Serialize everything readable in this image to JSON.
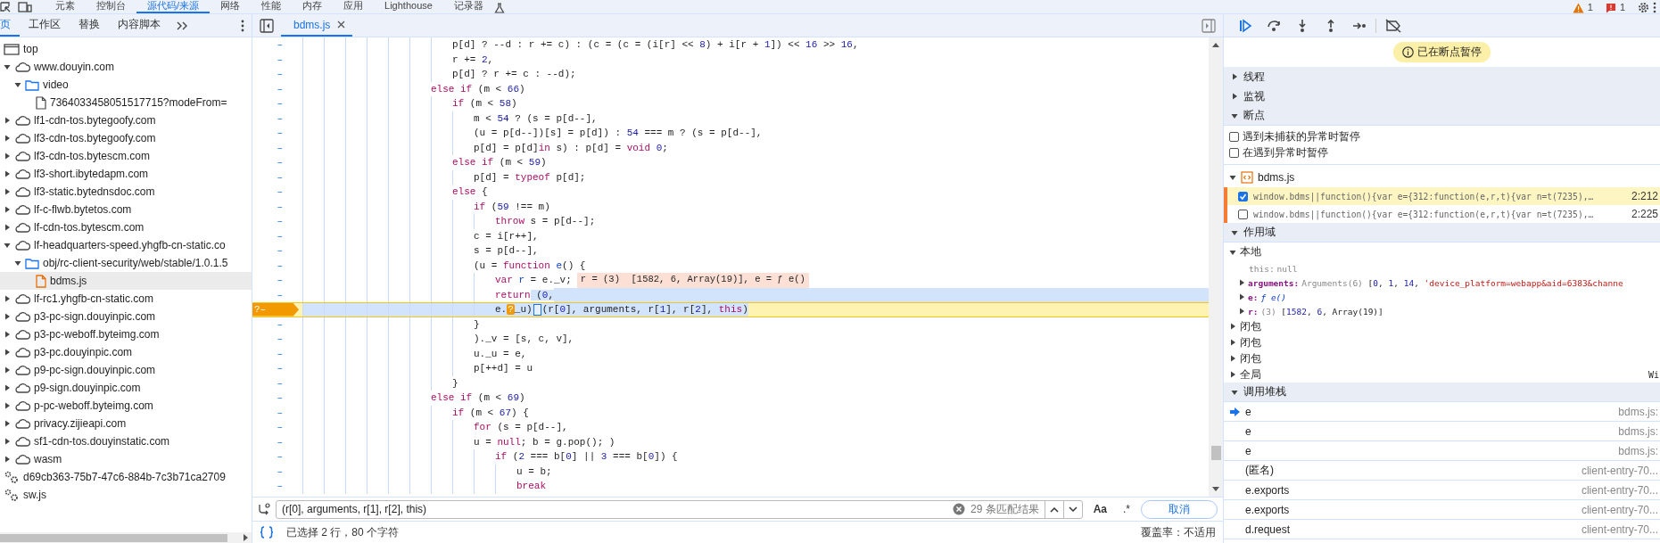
{
  "top_tabs": [
    {
      "label": "元素",
      "selected": false
    },
    {
      "label": "控制台",
      "selected": false
    },
    {
      "label": "源代码/来源",
      "selected": true
    },
    {
      "label": "网络",
      "selected": false
    },
    {
      "label": "性能",
      "selected": false
    },
    {
      "label": "内存",
      "selected": false
    },
    {
      "label": "应用",
      "selected": false
    },
    {
      "label": "Lighthouse",
      "selected": false
    },
    {
      "label": "记录器",
      "selected": false
    }
  ],
  "top_status": {
    "warnings": "1",
    "errors": "1"
  },
  "navigator": {
    "tabs": [
      {
        "label": "页",
        "selected": true
      },
      {
        "label": "工作区",
        "selected": false
      },
      {
        "label": "替换",
        "selected": false
      },
      {
        "label": "内容脚本",
        "selected": false
      }
    ],
    "tree": [
      {
        "kind": "frame",
        "label": "top",
        "selected": false
      },
      {
        "kind": "domain",
        "label": "www.douyin.com",
        "expanded": true,
        "selected": false,
        "children": [
          {
            "kind": "folder",
            "label": "video",
            "expanded": true,
            "selected": false,
            "children": [
              {
                "kind": "file",
                "label": "7364033458051517715?modeFrom=",
                "selected": false
              }
            ]
          }
        ]
      },
      {
        "kind": "domain",
        "label": "lf1-cdn-tos.bytegoofy.com",
        "expanded": false,
        "selected": false
      },
      {
        "kind": "domain",
        "label": "lf3-cdn-tos.bytegoofy.com",
        "expanded": false,
        "selected": false
      },
      {
        "kind": "domain",
        "label": "lf3-cdn-tos.bytescm.com",
        "expanded": false,
        "selected": false
      },
      {
        "kind": "domain",
        "label": "lf3-short.ibytedapm.com",
        "expanded": false,
        "selected": false
      },
      {
        "kind": "domain",
        "label": "lf3-static.bytednsdoc.com",
        "expanded": false,
        "selected": false
      },
      {
        "kind": "domain",
        "label": "lf-c-flwb.bytetos.com",
        "expanded": false,
        "selected": false
      },
      {
        "kind": "domain",
        "label": "lf-cdn-tos.bytescm.com",
        "expanded": false,
        "selected": false
      },
      {
        "kind": "domain",
        "label": "lf-headquarters-speed.yhgfb-cn-static.co",
        "expanded": true,
        "selected": false,
        "children": [
          {
            "kind": "folder",
            "label": "obj/rc-client-security/web/stable/1.0.1.5",
            "expanded": true,
            "selected": false,
            "children": [
              {
                "kind": "script",
                "label": "bdms.js",
                "selected": true
              }
            ]
          }
        ]
      },
      {
        "kind": "domain",
        "label": "lf-rc1.yhgfb-cn-static.com",
        "expanded": false,
        "selected": false
      },
      {
        "kind": "domain",
        "label": "p3-pc-sign.douyinpic.com",
        "expanded": false,
        "selected": false
      },
      {
        "kind": "domain",
        "label": "p3-pc-weboff.byteimg.com",
        "expanded": false,
        "selected": false
      },
      {
        "kind": "domain",
        "label": "p3-pc.douyinpic.com",
        "expanded": false,
        "selected": false
      },
      {
        "kind": "domain",
        "label": "p9-pc-sign.douyinpic.com",
        "expanded": false,
        "selected": false
      },
      {
        "kind": "domain",
        "label": "p9-sign.douyinpic.com",
        "expanded": false,
        "selected": false
      },
      {
        "kind": "domain",
        "label": "p-pc-weboff.byteimg.com",
        "expanded": false,
        "selected": false
      },
      {
        "kind": "domain",
        "label": "privacy.zijieapi.com",
        "expanded": false,
        "selected": false
      },
      {
        "kind": "domain",
        "label": "sf1-cdn-tos.douyinstatic.com",
        "expanded": false,
        "selected": false
      },
      {
        "kind": "domain",
        "label": "wasm",
        "expanded": false,
        "selected": false
      },
      {
        "kind": "worker",
        "label": "d69cb363-75b7-47c6-884b-7c3b71ca2709",
        "selected": false
      },
      {
        "kind": "worker",
        "label": "sw.js",
        "selected": false
      }
    ]
  },
  "editor": {
    "tabs": [
      {
        "label": "bdms.js",
        "selected": true
      }
    ],
    "lines": [
      {
        "marker": "–",
        "paused": false,
        "selected": false,
        "code": [
          {
            "kind": "plain",
            "text": "\t\t\t\t\t\t\tp[d] ? --d : r += c) : (c = (c = (i[r] <<"
          },
          {
            "kind": "number",
            "text": " 8"
          },
          {
            "kind": "plain",
            "text": ") + i[r +"
          },
          {
            "kind": "number",
            "text": " 1"
          },
          {
            "kind": "plain",
            "text": "]) <<"
          },
          {
            "kind": "number",
            "text": " 16"
          },
          {
            "kind": "plain",
            "text": " >>"
          },
          {
            "kind": "number",
            "text": " 16"
          },
          {
            "kind": "plain",
            "text": ","
          }
        ]
      },
      {
        "marker": "–",
        "paused": false,
        "selected": false,
        "code": [
          {
            "kind": "plain",
            "text": "\t\t\t\t\t\t\tr +="
          },
          {
            "kind": "number",
            "text": " 2"
          },
          {
            "kind": "plain",
            "text": ","
          }
        ]
      },
      {
        "marker": "–",
        "paused": false,
        "selected": false,
        "code": [
          {
            "kind": "plain",
            "text": "\t\t\t\t\t\t\tp[d] ? r += c : --d);"
          }
        ]
      },
      {
        "marker": "–",
        "paused": false,
        "selected": false,
        "code": [
          {
            "kind": "keyword",
            "text": "\t\t\t\t\t\telse if"
          },
          {
            "kind": "plain",
            "text": " (m <"
          },
          {
            "kind": "number",
            "text": " 66"
          },
          {
            "kind": "plain",
            "text": ")"
          }
        ]
      },
      {
        "marker": "–",
        "paused": false,
        "selected": false,
        "code": [
          {
            "kind": "keyword",
            "text": "\t\t\t\t\t\t\tif"
          },
          {
            "kind": "plain",
            "text": " (m <"
          },
          {
            "kind": "number",
            "text": " 58"
          },
          {
            "kind": "plain",
            "text": ")"
          }
        ]
      },
      {
        "marker": "–",
        "paused": false,
        "selected": false,
        "code": [
          {
            "kind": "plain",
            "text": "\t\t\t\t\t\t\t\tm <"
          },
          {
            "kind": "number",
            "text": " 54"
          },
          {
            "kind": "plain",
            "text": " ? (s = p[d--],"
          }
        ]
      },
      {
        "marker": "–",
        "paused": false,
        "selected": false,
        "code": [
          {
            "kind": "plain",
            "text": "\t\t\t\t\t\t\t\t(u = p[d--])[s] = p[d]) :"
          },
          {
            "kind": "number",
            "text": " 54"
          },
          {
            "kind": "plain",
            "text": " === m ? (s = p[d--],"
          }
        ]
      },
      {
        "marker": "–",
        "paused": false,
        "selected": false,
        "code": [
          {
            "kind": "plain",
            "text": "\t\t\t\t\t\t\t\tp[d] = p[d]"
          },
          {
            "kind": "keyword",
            "text": "in"
          },
          {
            "kind": "plain",
            "text": " s) : p[d] ="
          },
          {
            "kind": "keyword",
            "text": " void"
          },
          {
            "kind": "number",
            "text": " 0"
          },
          {
            "kind": "plain",
            "text": ";"
          }
        ]
      },
      {
        "marker": "–",
        "paused": false,
        "selected": false,
        "code": [
          {
            "kind": "keyword",
            "text": "\t\t\t\t\t\t\telse if"
          },
          {
            "kind": "plain",
            "text": " (m <"
          },
          {
            "kind": "number",
            "text": " 59"
          },
          {
            "kind": "plain",
            "text": ")"
          }
        ]
      },
      {
        "marker": "–",
        "paused": false,
        "selected": false,
        "code": [
          {
            "kind": "plain",
            "text": "\t\t\t\t\t\t\t\tp[d] ="
          },
          {
            "kind": "keyword",
            "text": " typeof"
          },
          {
            "kind": "plain",
            "text": " p[d];"
          }
        ]
      },
      {
        "marker": "–",
        "paused": false,
        "selected": false,
        "code": [
          {
            "kind": "keyword",
            "text": "\t\t\t\t\t\t\telse"
          },
          {
            "kind": "plain",
            "text": " {"
          }
        ]
      },
      {
        "marker": "–",
        "paused": false,
        "selected": false,
        "code": [
          {
            "kind": "keyword",
            "text": "\t\t\t\t\t\t\t\tif"
          },
          {
            "kind": "plain",
            "text": " ("
          },
          {
            "kind": "number",
            "text": "59"
          },
          {
            "kind": "plain",
            "text": " !== m)"
          }
        ]
      },
      {
        "marker": "–",
        "paused": false,
        "selected": false,
        "code": [
          {
            "kind": "keyword",
            "text": "\t\t\t\t\t\t\t\t\tthrow"
          },
          {
            "kind": "plain",
            "text": " s = p[d--];"
          }
        ]
      },
      {
        "marker": "–",
        "paused": false,
        "selected": false,
        "code": [
          {
            "kind": "plain",
            "text": "\t\t\t\t\t\t\t\tc = i[r++],"
          }
        ]
      },
      {
        "marker": "–",
        "paused": false,
        "selected": false,
        "code": [
          {
            "kind": "plain",
            "text": "\t\t\t\t\t\t\t\ts = p[d--],"
          }
        ]
      },
      {
        "marker": "–",
        "paused": false,
        "selected": false,
        "code": [
          {
            "kind": "plain",
            "text": "\t\t\t\t\t\t\t\t(u ="
          },
          {
            "kind": "keyword",
            "text": " function"
          },
          {
            "kind": "name",
            "text": " e"
          },
          {
            "kind": "plain",
            "text": "() {"
          }
        ]
      },
      {
        "marker": "–",
        "paused": false,
        "selected": false,
        "code": [
          {
            "kind": "keyword",
            "text": "\t\t\t\t\t\t\t\t\tvar"
          },
          {
            "kind": "name",
            "text": " r"
          },
          {
            "kind": "plain",
            "text": " = e._v;"
          }
        ],
        "inline_value": "r = (3)  [1582, 6, Array(19)], e = ƒ e()"
      },
      {
        "marker": "–",
        "paused": false,
        "selected": false,
        "code": [
          {
            "kind": "keyword",
            "text": "\t\t\t\t\t\t\t\t\treturn"
          }
        ],
        "selected_tail": [
          {
            "kind": "plain",
            "text": " ("
          },
          {
            "kind": "number",
            "text": "0"
          },
          {
            "kind": "plain",
            "text": ","
          }
        ]
      },
      {
        "marker": "–",
        "badge": "?",
        "paused": true,
        "selected": true,
        "code": [
          {
            "kind": "plain",
            "text": "\t\t\t\t\t\t\t\t\te."
          },
          {
            "kind": "pause-marker",
            "text": "?"
          },
          {
            "kind": "plain",
            "text": "_u)"
          },
          {
            "kind": "step-marker"
          },
          {
            "kind": "plain",
            "text": "(r["
          },
          {
            "kind": "number",
            "text": "0"
          },
          {
            "kind": "plain",
            "text": "], arguments, r["
          },
          {
            "kind": "number",
            "text": "1"
          },
          {
            "kind": "plain",
            "text": "], r["
          },
          {
            "kind": "number",
            "text": "2"
          },
          {
            "kind": "plain",
            "text": "],"
          },
          {
            "kind": "keyword",
            "text": " this"
          },
          {
            "kind": "plain",
            "text": ")"
          }
        ]
      },
      {
        "marker": "–",
        "paused": false,
        "selected": false,
        "code": [
          {
            "kind": "plain",
            "text": "\t\t\t\t\t\t\t\t}"
          }
        ]
      },
      {
        "marker": "–",
        "paused": false,
        "selected": false,
        "code": [
          {
            "kind": "plain",
            "text": "\t\t\t\t\t\t\t\t)._v = [s, c, v],"
          }
        ]
      },
      {
        "marker": "–",
        "paused": false,
        "selected": false,
        "code": [
          {
            "kind": "plain",
            "text": "\t\t\t\t\t\t\t\tu._u = e,"
          }
        ]
      },
      {
        "marker": "–",
        "paused": false,
        "selected": false,
        "code": [
          {
            "kind": "plain",
            "text": "\t\t\t\t\t\t\t\tp[++d] = u"
          }
        ]
      },
      {
        "marker": "–",
        "paused": false,
        "selected": false,
        "code": [
          {
            "kind": "plain",
            "text": "\t\t\t\t\t\t\t}"
          }
        ]
      },
      {
        "marker": "–",
        "paused": false,
        "selected": false,
        "code": [
          {
            "kind": "keyword",
            "text": "\t\t\t\t\t\telse if"
          },
          {
            "kind": "plain",
            "text": " (m <"
          },
          {
            "kind": "number",
            "text": " 69"
          },
          {
            "kind": "plain",
            "text": ")"
          }
        ]
      },
      {
        "marker": "–",
        "paused": false,
        "selected": false,
        "code": [
          {
            "kind": "keyword",
            "text": "\t\t\t\t\t\t\tif"
          },
          {
            "kind": "plain",
            "text": " (m <"
          },
          {
            "kind": "number",
            "text": " 67"
          },
          {
            "kind": "plain",
            "text": ") {"
          }
        ]
      },
      {
        "marker": "–",
        "paused": false,
        "selected": false,
        "code": [
          {
            "kind": "keyword",
            "text": "\t\t\t\t\t\t\t\tfor"
          },
          {
            "kind": "plain",
            "text": " (s = p[d--],"
          }
        ]
      },
      {
        "marker": "–",
        "paused": false,
        "selected": false,
        "code": [
          {
            "kind": "plain",
            "text": "\t\t\t\t\t\t\t\tu ="
          },
          {
            "kind": "keyword",
            "text": " null"
          },
          {
            "kind": "plain",
            "text": "; b = g.pop(); )"
          }
        ]
      },
      {
        "marker": "–",
        "paused": false,
        "selected": false,
        "code": [
          {
            "kind": "keyword",
            "text": "\t\t\t\t\t\t\t\t\tif"
          },
          {
            "kind": "plain",
            "text": " ("
          },
          {
            "kind": "number",
            "text": "2"
          },
          {
            "kind": "plain",
            "text": " === b["
          },
          {
            "kind": "number",
            "text": "0"
          },
          {
            "kind": "plain",
            "text": "] ||"
          },
          {
            "kind": "number",
            "text": " 3"
          },
          {
            "kind": "plain",
            "text": " === b["
          },
          {
            "kind": "number",
            "text": "0"
          },
          {
            "kind": "plain",
            "text": "]) {"
          }
        ]
      },
      {
        "marker": "–",
        "paused": false,
        "selected": false,
        "code": [
          {
            "kind": "plain",
            "text": "\t\t\t\t\t\t\t\t\t\tu = b;"
          }
        ]
      },
      {
        "marker": "–",
        "paused": false,
        "selected": false,
        "code": [
          {
            "kind": "keyword",
            "text": "\t\t\t\t\t\t\t\t\t\tbreak"
          }
        ]
      }
    ],
    "search": {
      "value": "(r[0], arguments, r[1], r[2], this)",
      "match_count": "29 条匹配结果",
      "case_button": "Aa",
      "regex_button": ".*",
      "cancel_button": "取消"
    },
    "status": {
      "selection": "已选择 2 行，80 个字符",
      "coverage": "覆盖率：不适用"
    }
  },
  "debugger": {
    "paused_message": "已在断点暂停",
    "sections": [
      {
        "title": "线程",
        "expanded": false
      },
      {
        "title": "监视",
        "expanded": false
      },
      {
        "kind": "breakpoints",
        "title": "断点",
        "expanded": true,
        "options": [
          {
            "label": "遇到未捕获的异常时暂停",
            "checked": false
          },
          {
            "label": "在遇到异常时暂停",
            "checked": false
          }
        ],
        "files": [
          {
            "name": "bdms.js",
            "expanded": true,
            "breakpoints": [
              {
                "text": "window.bdms||function(){var e={312:function(e,r,t){var n=t(7235),…",
                "location": "2:212",
                "checked": true,
                "selected": true
              },
              {
                "text": "window.bdms||function(){var e={312:function(e,r,t){var n=t(7235),…",
                "location": "2:225",
                "checked": false,
                "selected": false
              }
            ]
          }
        ]
      },
      {
        "kind": "scope",
        "title": "作用域",
        "expanded": true,
        "groups": [
          {
            "label": "本地",
            "expanded": true,
            "vars": [
              {
                "kind": "internal",
                "name": "this:",
                "expandable": false,
                "value": [
                  {
                    "kind": "grey",
                    "text": "null"
                  }
                ]
              },
              {
                "kind": "own",
                "name": "arguments:",
                "expandable": true,
                "value": [
                  {
                    "kind": "grey",
                    "text": "Arguments(6)"
                  },
                  {
                    "kind": "plain",
                    "text": "  ["
                  },
                  {
                    "kind": "number",
                    "text": "0"
                  },
                  {
                    "kind": "plain",
                    "text": ","
                  },
                  {
                    "kind": "number",
                    "text": " 1"
                  },
                  {
                    "kind": "plain",
                    "text": ","
                  },
                  {
                    "kind": "number",
                    "text": " 14"
                  },
                  {
                    "kind": "plain",
                    "text": ","
                  },
                  {
                    "kind": "string",
                    "text": " 'device_platform=webapp&aid=6383&channe"
                  }
                ]
              },
              {
                "kind": "own",
                "name": "e:",
                "expandable": true,
                "value": [
                  {
                    "kind": "function",
                    "text": "ƒ e()"
                  }
                ]
              },
              {
                "kind": "own",
                "name": "r:",
                "expandable": true,
                "value": [
                  {
                    "kind": "grey",
                    "text": "(3)"
                  },
                  {
                    "kind": "plain",
                    "text": "  ["
                  },
                  {
                    "kind": "number",
                    "text": "1582"
                  },
                  {
                    "kind": "plain",
                    "text": ","
                  },
                  {
                    "kind": "number",
                    "text": " 6"
                  },
                  {
                    "kind": "plain",
                    "text": ", Array(19)]"
                  }
                ]
              }
            ]
          },
          {
            "label": "闭包",
            "expanded": false
          },
          {
            "label": "闭包",
            "expanded": false
          },
          {
            "label": "闭包",
            "expanded": false
          },
          {
            "label": "全局",
            "expanded": false,
            "value": "Wi"
          }
        ]
      },
      {
        "kind": "stack",
        "title": "调用堆栈",
        "expanded": true,
        "frames": [
          {
            "name": "e",
            "location": "bdms.js:",
            "current": true
          },
          {
            "name": "e",
            "location": "bdms.js:",
            "current": false
          },
          {
            "name": "e",
            "location": "bdms.js:",
            "current": false
          },
          {
            "name": "(匿名)",
            "location": "client-entry-70...",
            "current": false
          },
          {
            "name": "e.exports",
            "location": "client-entry-70...",
            "current": false
          },
          {
            "name": "e.exports",
            "location": "client-entry-70...",
            "current": false
          },
          {
            "name": "d.request",
            "location": "client-entry-70...",
            "current": false
          }
        ]
      }
    ]
  }
}
